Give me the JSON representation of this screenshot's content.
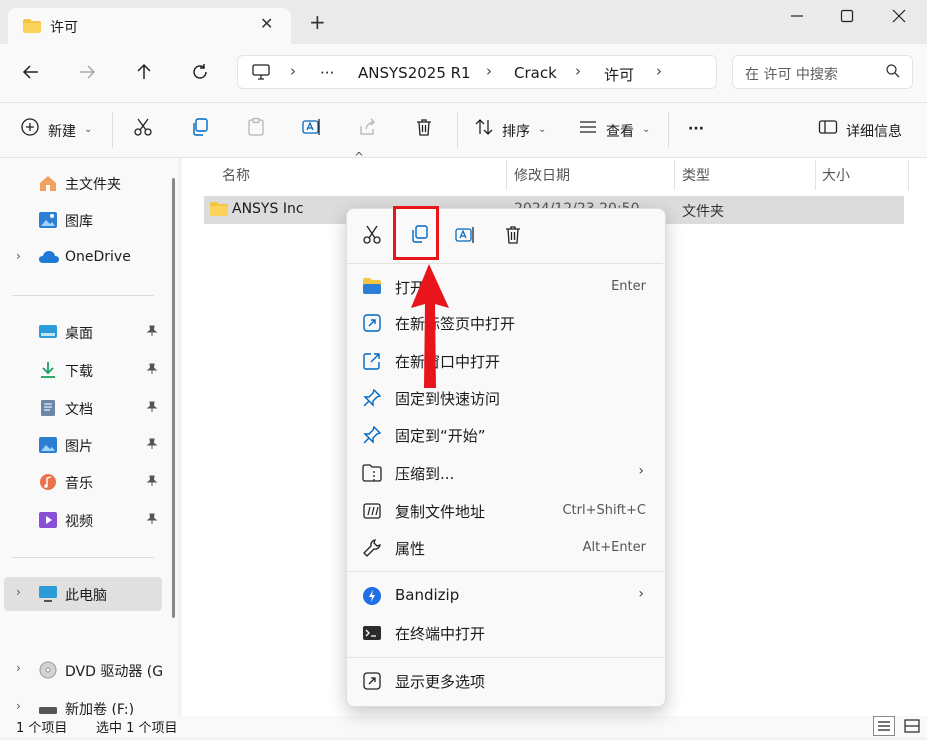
{
  "window": {
    "tab_title": "许可",
    "new_tab_symbol": "+"
  },
  "address": {
    "ellipsis": "···",
    "crumbs": [
      "ANSYS2025 R1",
      "Crack",
      "许可"
    ]
  },
  "search": {
    "placeholder": "在 许可 中搜索"
  },
  "toolbar": {
    "new_label": "新建",
    "sort_label": "排序",
    "view_label": "查看",
    "more_label": "···",
    "details_label": "详细信息"
  },
  "sidebar": {
    "home": "主文件夹",
    "gallery": "图库",
    "onedrive": "OneDrive",
    "desktop": "桌面",
    "downloads": "下载",
    "documents": "文档",
    "pictures": "图片",
    "music": "音乐",
    "videos": "视频",
    "this_pc": "此电脑",
    "dvd": "DVD 驱动器 (G",
    "new_volume": "新加卷 (F:)"
  },
  "columns": {
    "name": "名称",
    "date": "修改日期",
    "type": "类型",
    "size": "大小"
  },
  "files": [
    {
      "name": "ANSYS Inc",
      "date": "2024/12/23 20:50",
      "type": "文件夹"
    }
  ],
  "context_menu": {
    "items": [
      {
        "label": "打开",
        "shortcut": "Enter"
      },
      {
        "label": "在新标签页中打开",
        "shortcut": ""
      },
      {
        "label": "在新窗口中打开",
        "shortcut": ""
      },
      {
        "label": "固定到快速访问",
        "shortcut": ""
      },
      {
        "label": "固定到“开始”",
        "shortcut": ""
      },
      {
        "label": "压缩到...",
        "shortcut": ""
      },
      {
        "label": "复制文件地址",
        "shortcut": "Ctrl+Shift+C"
      },
      {
        "label": "属性",
        "shortcut": "Alt+Enter"
      },
      {
        "label": "Bandizip",
        "shortcut": ""
      },
      {
        "label": "在终端中打开",
        "shortcut": ""
      },
      {
        "label": "显示更多选项",
        "shortcut": ""
      }
    ]
  },
  "status": {
    "count": "1 个项目",
    "selected": "选中 1 个项目"
  },
  "colors": {
    "highlight": "#e8141c",
    "folder": "#f5c542",
    "accent": "#0067c0"
  }
}
